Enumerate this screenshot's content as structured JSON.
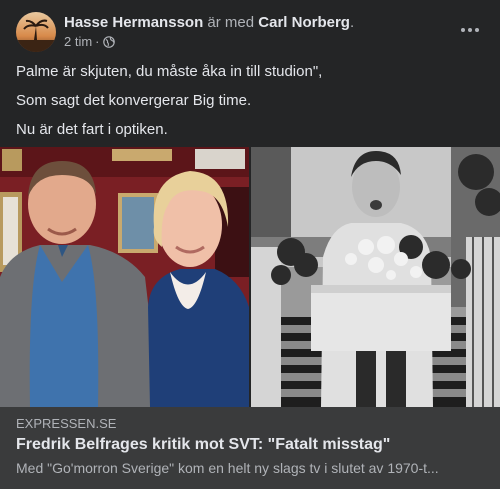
{
  "post": {
    "author": "Hasse Hermansson",
    "with_text": "är med",
    "tagged": "Carl Norberg",
    "tagged_suffix": ".",
    "time": "2 tim",
    "separator": "·",
    "privacy_icon": "globe-icon",
    "menu_icon": "more-options-icon",
    "text_lines": [
      "Palme är skjuten, du måste åka in till studion\",",
      "Som sagt det konvergerar Big time.",
      "Nu är det fart i optiken."
    ]
  },
  "link_preview": {
    "domain": "EXPRESSEN.SE",
    "title": "Fredrik Belfrages kritik mot SVT: \"Fatalt misstag\"",
    "description": "Med \"Go'morron Sverige\" kom en helt ny slags tv i slutet av 1970-t..."
  },
  "colors": {
    "background": "#242526",
    "link_box": "#3a3b3c",
    "text_primary": "#e4e6eb",
    "text_secondary": "#b0b3b8"
  }
}
